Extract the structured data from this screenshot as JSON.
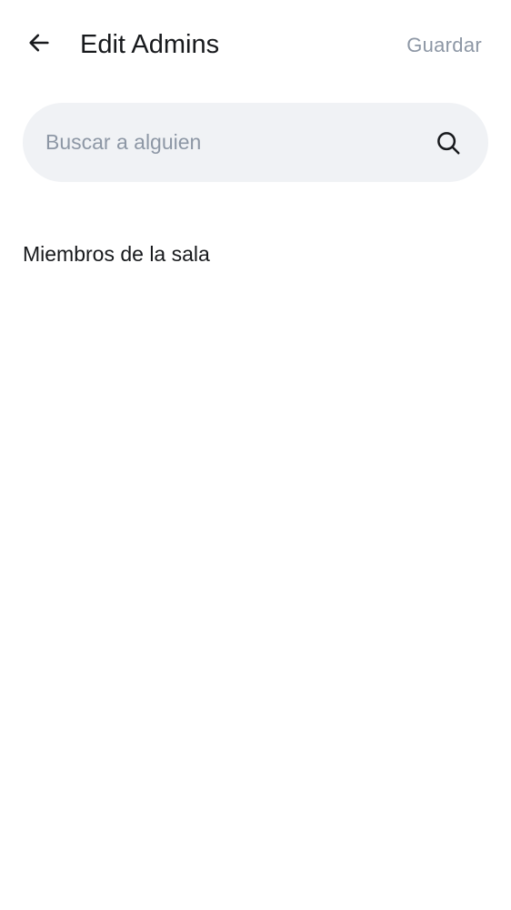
{
  "header": {
    "back_icon": "arrow-left-icon",
    "title": "Edit Admins",
    "save_label": "Guardar"
  },
  "search": {
    "value": "",
    "placeholder": "Buscar a alguien",
    "icon": "search-icon"
  },
  "members_section": {
    "title": "Miembros de la sala",
    "members": []
  },
  "colors": {
    "background": "#ffffff",
    "text_primary": "#17191c",
    "text_secondary": "#8d97a5",
    "search_background": "#f0f2f5"
  }
}
